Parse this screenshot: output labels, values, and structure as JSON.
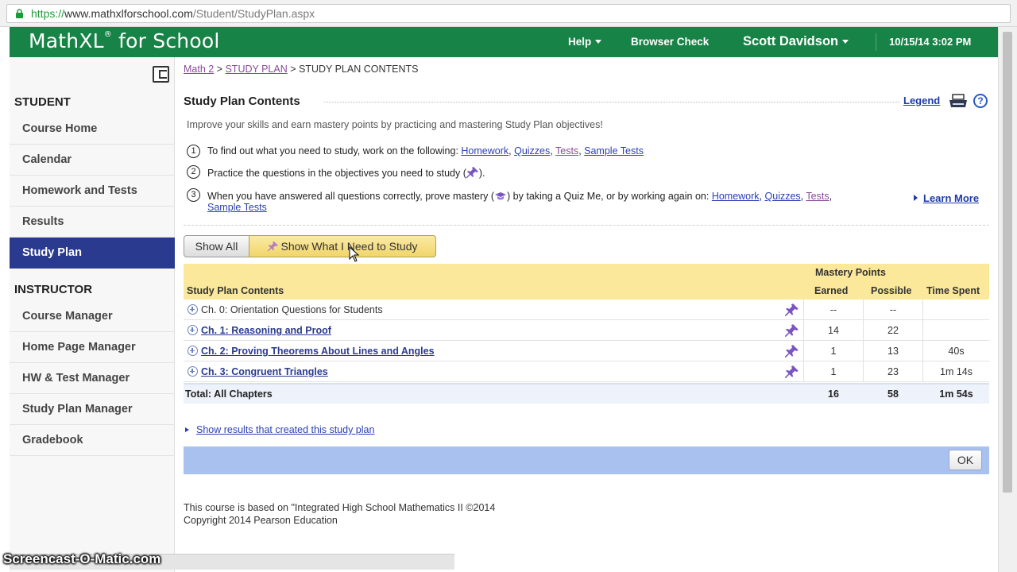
{
  "browser": {
    "url_proto": "https://",
    "url_host": "www.mathxlforschool.com",
    "url_path": "/Student/StudyPlan.aspx"
  },
  "header": {
    "logo_text": "MathXL",
    "logo_reg": "®",
    "logo_suffix": " for School",
    "help_label": "Help",
    "browser_check_label": "Browser Check",
    "user_name": "Scott Davidson",
    "datetime": "10/15/14 3:02 PM",
    "bg_color": "#178346"
  },
  "sidebar": {
    "student_heading": "STUDENT",
    "student_items": [
      {
        "label": "Course Home"
      },
      {
        "label": "Calendar"
      },
      {
        "label": "Homework and Tests"
      },
      {
        "label": "Results"
      },
      {
        "label": "Study Plan",
        "active": true
      }
    ],
    "instructor_heading": "INSTRUCTOR",
    "instructor_items": [
      {
        "label": "Course Manager"
      },
      {
        "label": "Home Page Manager"
      },
      {
        "label": "HW & Test Manager"
      },
      {
        "label": "Study Plan Manager"
      },
      {
        "label": "Gradebook"
      }
    ],
    "active_color": "#2a3b8f"
  },
  "breadcrumb": {
    "link1": "Math 2",
    "sep": " > ",
    "link2": "STUDY PLAN",
    "current": "STUDY PLAN CONTENTS"
  },
  "section": {
    "title": "Study Plan Contents",
    "legend_label": "Legend",
    "help_symbol": "?"
  },
  "intro": "Improve your skills and earn mastery points by practicing and mastering Study Plan objectives!",
  "steps": {
    "step1": {
      "num": "1",
      "text": "To find out what you need to study, work on the following: ",
      "links": [
        "Homework",
        "Quizzes",
        "Tests",
        "Sample Tests"
      ]
    },
    "step2": {
      "num": "2",
      "text_before": "Practice the questions in the objectives you need to study (",
      "text_after": ")."
    },
    "step3": {
      "num": "3",
      "text_before": "When you have answered all questions correctly, prove mastery (",
      "text_mid": ") by taking a Quiz Me, or by working again on: ",
      "links": [
        "Homework",
        "Quizzes",
        "Tests",
        "Sample Tests"
      ]
    },
    "learn_more": "Learn More"
  },
  "filters": {
    "show_all": "Show All",
    "show_need": "Show What I Need to Study"
  },
  "table": {
    "contents_header": "Study Plan Contents",
    "mastery_header": "Mastery Points",
    "earned_header": "Earned",
    "possible_header": "Possible",
    "time_header": "Time Spent",
    "rows": [
      {
        "chapter": "Ch. 0: Orientation Questions for Students",
        "earned": "--",
        "possible": "--",
        "time": "",
        "link": false
      },
      {
        "chapter": "Ch. 1: Reasoning and Proof",
        "earned": "14",
        "possible": "22",
        "time": "",
        "link": true
      },
      {
        "chapter": "Ch. 2: Proving Theorems About Lines and Angles",
        "earned": "1",
        "possible": "13",
        "time": "40s",
        "link": true
      },
      {
        "chapter": "Ch. 3: Congruent Triangles",
        "earned": "1",
        "possible": "23",
        "time": "1m 14s",
        "link": true
      }
    ],
    "total": {
      "label": "Total: All Chapters",
      "earned": "16",
      "possible": "58",
      "time": "1m 54s"
    },
    "header_color": "#fbe89a"
  },
  "show_results_link": "Show results that created this study plan",
  "ok_label": "OK",
  "footer": {
    "line1": "This course is based on \"Integrated High School Mathematics II ©2014",
    "line2": "Copyright 2014 Pearson Education"
  },
  "watermark": "Screencast-O-Matic.com"
}
